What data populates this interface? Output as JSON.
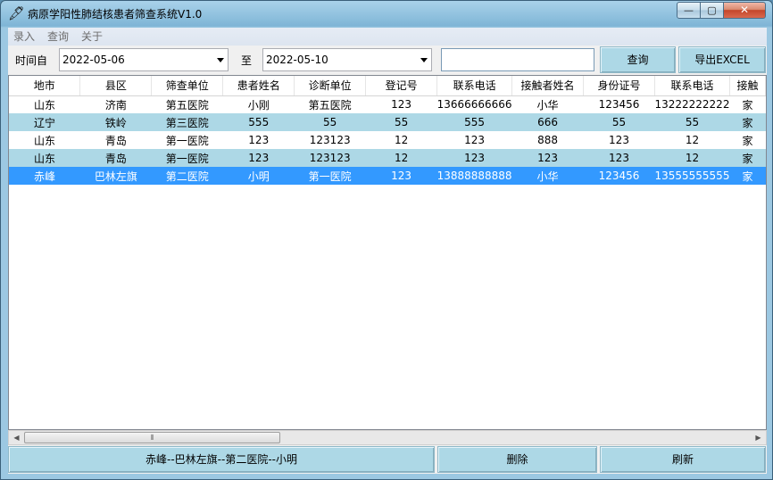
{
  "window": {
    "title": "病原学阳性肺结核患者筛查系统V1.0",
    "app_icon": "feather-icon",
    "min_glyph": "—",
    "max_glyph": "▢",
    "close_glyph": "✕"
  },
  "menu": [
    "录入",
    "查询",
    "关于"
  ],
  "filter": {
    "from_label": "时间自",
    "from_value": "2022-05-06",
    "to_label": "至",
    "to_value": "2022-05-10",
    "search_value": "",
    "query_label": "查询",
    "export_label": "导出EXCEL"
  },
  "table": {
    "columns": [
      "地市",
      "县区",
      "筛查单位",
      "患者姓名",
      "诊断单位",
      "登记号",
      "联系电话",
      "接触者姓名",
      "身份证号",
      "联系电话",
      "接触"
    ],
    "rows": [
      [
        "山东",
        "济南",
        "第五医院",
        "小刚",
        "第五医院",
        "123",
        "13666666666",
        "小华",
        "123456",
        "13222222222",
        "家"
      ],
      [
        "辽宁",
        "铁岭",
        "第三医院",
        "555",
        "55",
        "55",
        "555",
        "666",
        "55",
        "55",
        "家"
      ],
      [
        "山东",
        "青岛",
        "第一医院",
        "123",
        "123123",
        "12",
        "123",
        "888",
        "123",
        "12",
        "家"
      ],
      [
        "山东",
        "青岛",
        "第一医院",
        "123",
        "123123",
        "12",
        "123",
        "123",
        "123",
        "12",
        "家"
      ],
      [
        "赤峰",
        "巴林左旗",
        "第二医院",
        "小明",
        "第一医院",
        "123",
        "13888888888",
        "小华",
        "123456",
        "13555555555",
        "家"
      ]
    ],
    "selected_row": 4
  },
  "scrollbar": {
    "left_arrow": "◀",
    "right_arrow": "▶",
    "grip": "⦀",
    "up_arrow": "▲",
    "down_arrow": "▼"
  },
  "footer": {
    "selection_label": "赤峰--巴林左旗--第二医院--小明",
    "delete_label": "删除",
    "refresh_label": "刷新"
  }
}
